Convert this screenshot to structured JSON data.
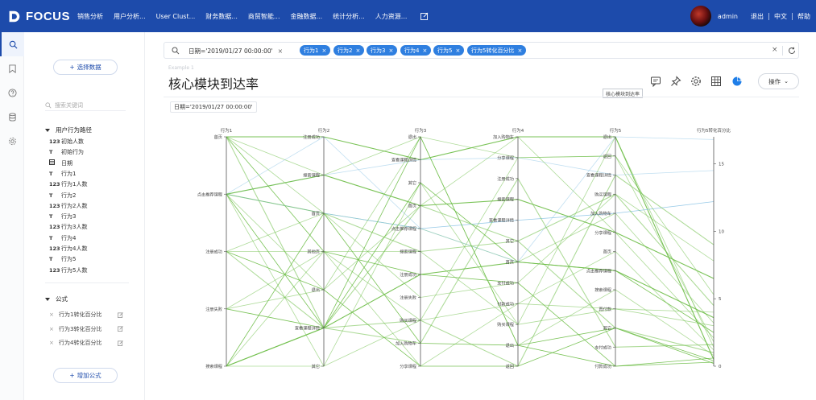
{
  "app": {
    "logo_text": "FOCUS",
    "nav_items": [
      "销售分析",
      "用户分析...",
      "User Clust...",
      "财务数据...",
      "商贸智能...",
      "金融数据...",
      "统计分析...",
      "人力资源..."
    ],
    "user_name": "admin",
    "logout": "退出",
    "language": "中文",
    "help": "帮助"
  },
  "panel": {
    "select_data_button": "选择数据",
    "search_placeholder": "搜索关键词",
    "group_title": "用户行为路径",
    "fields": [
      {
        "type": "123",
        "name": "初始人数"
      },
      {
        "type": "T",
        "name": "初始行为"
      },
      {
        "type": "date",
        "name": "日期"
      },
      {
        "type": "T",
        "name": "行为1"
      },
      {
        "type": "123",
        "name": "行为1人数"
      },
      {
        "type": "T",
        "name": "行为2"
      },
      {
        "type": "123",
        "name": "行为2人数"
      },
      {
        "type": "T",
        "name": "行为3"
      },
      {
        "type": "123",
        "name": "行为3人数"
      },
      {
        "type": "T",
        "name": "行为4"
      },
      {
        "type": "123",
        "name": "行为4人数"
      },
      {
        "type": "T",
        "name": "行为5"
      },
      {
        "type": "123",
        "name": "行为5人数"
      }
    ],
    "formula_title": "公式",
    "formulas": [
      "行为1转化百分比",
      "行为3转化百分比",
      "行为4转化百分比"
    ],
    "add_formula_button": "增加公式"
  },
  "filterbar": {
    "date_filter": "日期='2019/01/27 00:00:00'",
    "chips": [
      "行为1",
      "行为2",
      "行为3",
      "行为4",
      "行为5",
      "行为5转化百分比"
    ]
  },
  "main": {
    "breadcrumb": "Example 1",
    "title": "核心模块到达率",
    "operations_button": "操作",
    "tooltip": "核心模块到达率",
    "date_tag": "日期='2019/01/27 00:00:00'"
  },
  "colors": {
    "nav_bg": "#1d4bab",
    "chip_bg": "#2f7fe0",
    "line_green": "#6cbd45",
    "line_blue": "#8ec5e6"
  },
  "icons": {
    "rail": [
      "search-icon",
      "bookmark-icon",
      "help-icon",
      "database-icon",
      "settings-icon"
    ],
    "toolbar": [
      "comment-icon",
      "pin-icon",
      "settings-icon",
      "table-icon",
      "pie-chart-icon"
    ]
  },
  "chart_data": {
    "type": "parallel-coordinates",
    "axes": [
      {
        "name": "行为1",
        "categories": [
          "首页",
          "点击推荐课程",
          "注册成功",
          "注册失败",
          "搜索课程"
        ]
      },
      {
        "name": "行为2",
        "categories": [
          "注册成功",
          "搜索课程",
          "首页",
          "其他页",
          "退出",
          "查看课程详情",
          "其它"
        ]
      },
      {
        "name": "行为3",
        "categories": [
          "退出",
          "查看课程详情",
          "其它",
          "首页",
          "点击推荐课程",
          "搜索课程",
          "注册成功",
          "注册失败",
          "购买课程",
          "加入购物车",
          "分享课程"
        ]
      },
      {
        "name": "行为4",
        "categories": [
          "加入购物车",
          "分享课程",
          "注册成功",
          "搜索课程",
          "查看课程详情",
          "其它",
          "首页",
          "支付成功",
          "付款成功",
          "购买课程",
          "退出",
          "返回"
        ]
      },
      {
        "name": "行为5",
        "categories": [
          "退出",
          "返回",
          "查看课程详情",
          "购买课程",
          "加入购物车",
          "分享课程",
          "首页",
          "点击推荐课程",
          "搜索课程",
          "再付款",
          "其它",
          "支付成功",
          "付款成功"
        ]
      },
      {
        "name": "行为5转化百分比",
        "numeric": true,
        "ticks": [
          0,
          5,
          10,
          15
        ],
        "range": [
          0,
          17
        ]
      }
    ],
    "paths": [
      {
        "v": [
          "首页",
          "注册成功",
          "查看课程详情",
          "加入购物车",
          "退出",
          0.5
        ]
      },
      {
        "v": [
          "首页",
          "首页",
          "点击推荐课程",
          "首页",
          "加入购物车",
          3.2
        ]
      },
      {
        "v": [
          "首页",
          "搜索课程",
          "退出",
          "分享课程",
          "返回",
          1.8
        ]
      },
      {
        "v": [
          "首页",
          "其他页",
          "注册成功",
          "支付成功",
          "付款成功",
          0.3
        ]
      },
      {
        "v": [
          "首页",
          "查看课程详情",
          "首页",
          "其它",
          "其它",
          1.0
        ]
      },
      {
        "v": [
          "点击推荐课程",
          "搜索课程",
          "查看课程详情",
          "分享课程",
          "查看课程详情",
          14.5,
          "blue"
        ]
      },
      {
        "v": [
          "点击推荐课程",
          "首页",
          "点击推荐课程",
          "查看课程详情",
          "加入购物车",
          12.2,
          "blue"
        ]
      },
      {
        "v": [
          "点击推荐课程",
          "注册成功",
          "点击推荐课程",
          "首页",
          "退出",
          16.8,
          "blue"
        ]
      },
      {
        "v": [
          "点击推荐课程",
          "首页",
          "搜索课程",
          "其它",
          "购买课程",
          4.5
        ]
      },
      {
        "v": [
          "点击推荐课程",
          "查看课程详情",
          "其它",
          "首页",
          "点击推荐课程",
          2.5
        ]
      },
      {
        "v": [
          "点击推荐课程",
          "其它",
          "购买课程",
          "付款成功",
          "首页",
          1.2
        ]
      },
      {
        "v": [
          "点击推荐课程",
          "退出",
          "退出",
          "退出",
          "搜索课程",
          0.8
        ]
      },
      {
        "v": [
          "点击推荐课程",
          "搜索课程",
          "首页",
          "搜索课程",
          "分享课程",
          6.5
        ]
      },
      {
        "v": [
          "注册成功",
          "其他页",
          "搜索课程",
          "购买课程",
          "再付款",
          3.0
        ]
      },
      {
        "v": [
          "注册成功",
          "首页",
          "注册失败",
          "支付成功",
          "购买课程",
          7.8
        ]
      },
      {
        "v": [
          "注册成功",
          "退出",
          "分享课程",
          "返回",
          "其它",
          0.4
        ]
      },
      {
        "v": [
          "注册成功",
          "查看课程详情",
          "加入购物车",
          "注册成功",
          "支付成功",
          1.6
        ]
      },
      {
        "v": [
          "注册失败",
          "其他页",
          "购买课程",
          "分享课程",
          "返回",
          5.3
        ]
      },
      {
        "v": [
          "注册失败",
          "查看课程详情",
          "退出",
          "退出",
          "付款成功",
          0.6
        ]
      },
      {
        "v": [
          "注册失败",
          "退出",
          "首页",
          "加入购物车",
          "分享课程",
          2.1
        ]
      },
      {
        "v": [
          "搜索课程",
          "查看课程详情",
          "购买课程",
          "返回",
          "查看课程详情",
          9.0
        ]
      },
      {
        "v": [
          "搜索课程",
          "首页",
          "加入购物车",
          "退出",
          "其它",
          0.2
        ]
      },
      {
        "v": [
          "搜索课程",
          "其他页",
          "分享课程",
          "付款成功",
          "再付款",
          4.0
        ]
      },
      {
        "v": [
          "搜索课程",
          "其它",
          "其它",
          "购买课程",
          "退出",
          1.4
        ]
      },
      {
        "v": [
          "搜索课程",
          "查看课程详情",
          "注册成功",
          "首页",
          "点击推荐课程",
          3.6
        ]
      }
    ]
  }
}
